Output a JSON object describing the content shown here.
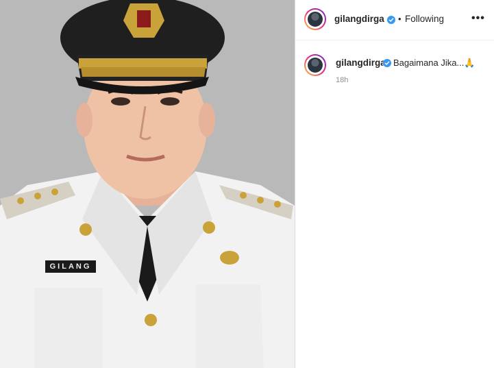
{
  "header": {
    "username": "gilangdirga",
    "separator": "•",
    "follow_status": "Following",
    "more_label": "•••"
  },
  "post": {
    "photo_name_tag": "GILANG",
    "caption_username": "gilangdirga",
    "caption_text": "Bagaimana Jika...🙏",
    "time_ago": "18h"
  },
  "colors": {
    "verified": "#3897f0",
    "photo_background": "#b9b9b9",
    "text": "#262626",
    "muted": "#8e8e8e"
  },
  "icons": {
    "verified": "verified-badge-icon",
    "more": "more-options-icon"
  }
}
